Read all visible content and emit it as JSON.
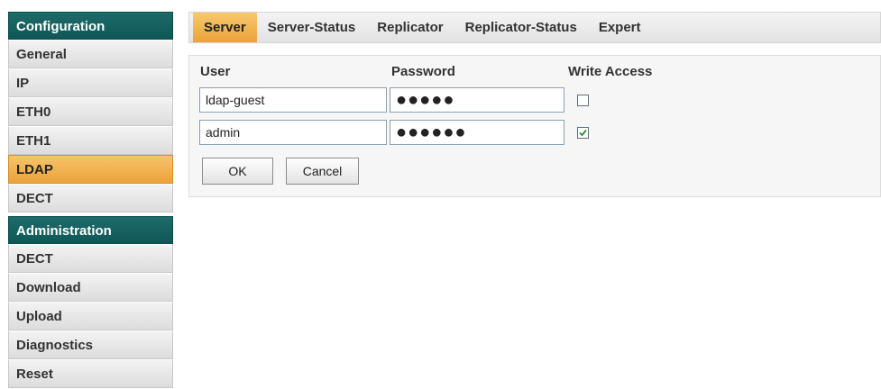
{
  "sidebar": {
    "groups": [
      {
        "header": "Configuration",
        "items": [
          "General",
          "IP",
          "ETH0",
          "ETH1",
          "LDAP",
          "DECT"
        ],
        "active": "LDAP"
      },
      {
        "header": "Administration",
        "items": [
          "DECT",
          "Download",
          "Upload",
          "Diagnostics",
          "Reset"
        ]
      }
    ]
  },
  "tabs": {
    "items": [
      "Server",
      "Server-Status",
      "Replicator",
      "Replicator-Status",
      "Expert"
    ],
    "active": "Server"
  },
  "form": {
    "headers": {
      "user": "User",
      "password": "Password",
      "write_access": "Write Access"
    },
    "rows": [
      {
        "user": "ldap-guest",
        "password": "●●●●●",
        "write_access": false
      },
      {
        "user": "admin",
        "password": "●●●●●●",
        "write_access": true
      }
    ],
    "ok_label": "OK",
    "cancel_label": "Cancel"
  },
  "colors": {
    "header_teal": "#0f5756",
    "active_orange": "#eba23a",
    "check_green": "#2e8b2e"
  }
}
